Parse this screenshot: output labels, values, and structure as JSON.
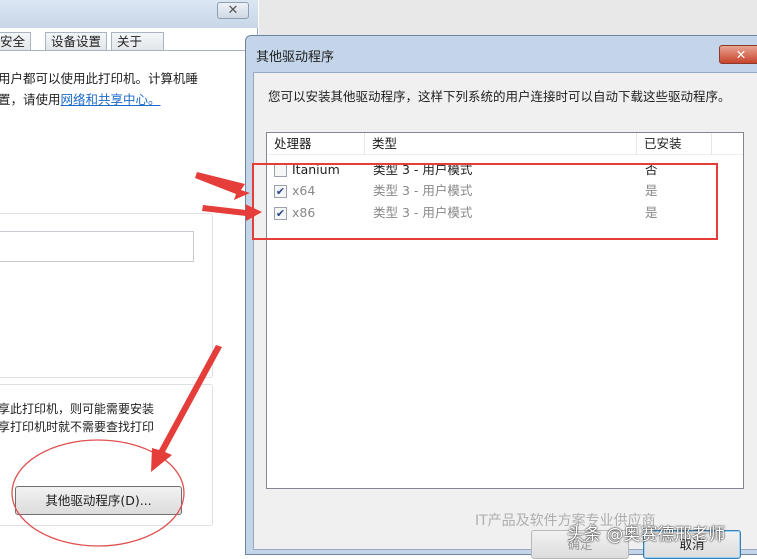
{
  "bg_window": {
    "close": "✕",
    "tabs": [
      "安全",
      "设备设置",
      "关于"
    ],
    "line1": "用户都可以使用此打印机。计算机睡",
    "line2_prefix": "置，请使用",
    "link": "网络和共享中心。",
    "driver_text1": "享此打印机，则可能需要安装",
    "driver_text2": "享打印机时就不需要查找打印",
    "other_drivers_button": "其他驱动程序(D)..."
  },
  "dialog": {
    "title": "其他驱动程序",
    "close": "✕",
    "description": "您可以安装其他驱动程序，这样下列系统的用户连接时可以自动下载这些驱动程序。",
    "columns": [
      "处理器",
      "类型",
      "已安装"
    ],
    "rows": [
      {
        "processor": "Itanium",
        "type": "类型 3 - 用户模式",
        "installed": "否",
        "checked": false,
        "check": ""
      },
      {
        "processor": "x64",
        "type": "类型 3 - 用户模式",
        "installed": "是",
        "checked": true,
        "check": "✔"
      },
      {
        "processor": "x86",
        "type": "类型 3 - 用户模式",
        "installed": "是",
        "checked": true,
        "check": "✔"
      }
    ],
    "ok": "确定",
    "cancel": "取消"
  },
  "watermark": {
    "text1": "IT产品及软件方案专业供应商",
    "text2": "头条 @奥赛德邢老师"
  },
  "annotation_color": "#e53d3a"
}
